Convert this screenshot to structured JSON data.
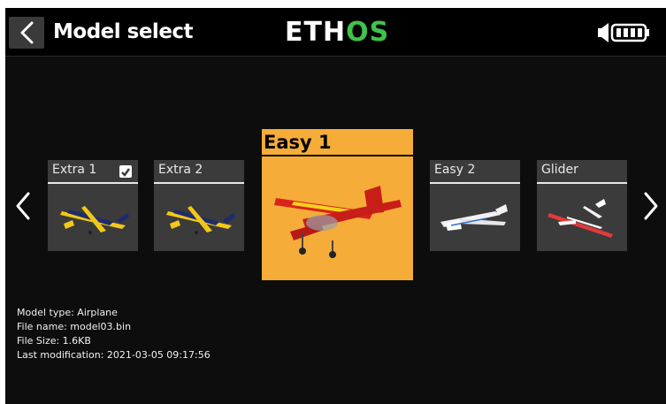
{
  "header": {
    "title": "Model select",
    "brand_part1": "ETH",
    "brand_part2": "OS",
    "brand_accent": "#3fc34a"
  },
  "carousel": {
    "prev_icon": "chevron-left-icon",
    "next_icon": "chevron-right-icon",
    "models": [
      {
        "name": "Extra 1",
        "checked": true,
        "icon": "aerobatic-plane-icon"
      },
      {
        "name": "Extra 2",
        "checked": false,
        "icon": "aerobatic-plane-icon"
      },
      {
        "name": "Easy 1",
        "selected": true,
        "icon": "trainer-plane-icon"
      },
      {
        "name": "Easy 2",
        "checked": false,
        "icon": "white-glider-icon"
      },
      {
        "name": "Glider",
        "checked": false,
        "icon": "red-glider-icon"
      }
    ],
    "selected_color": "#f6ac38"
  },
  "info": {
    "model_type": "Model type: Airplane",
    "file_name": "File name: model03.bin",
    "file_size": "File Size: 1.6KB",
    "last_modification": "Last modification: 2021-03-05 09:17:56"
  },
  "status": {
    "icons": [
      "speaker-icon",
      "battery-icon"
    ]
  }
}
